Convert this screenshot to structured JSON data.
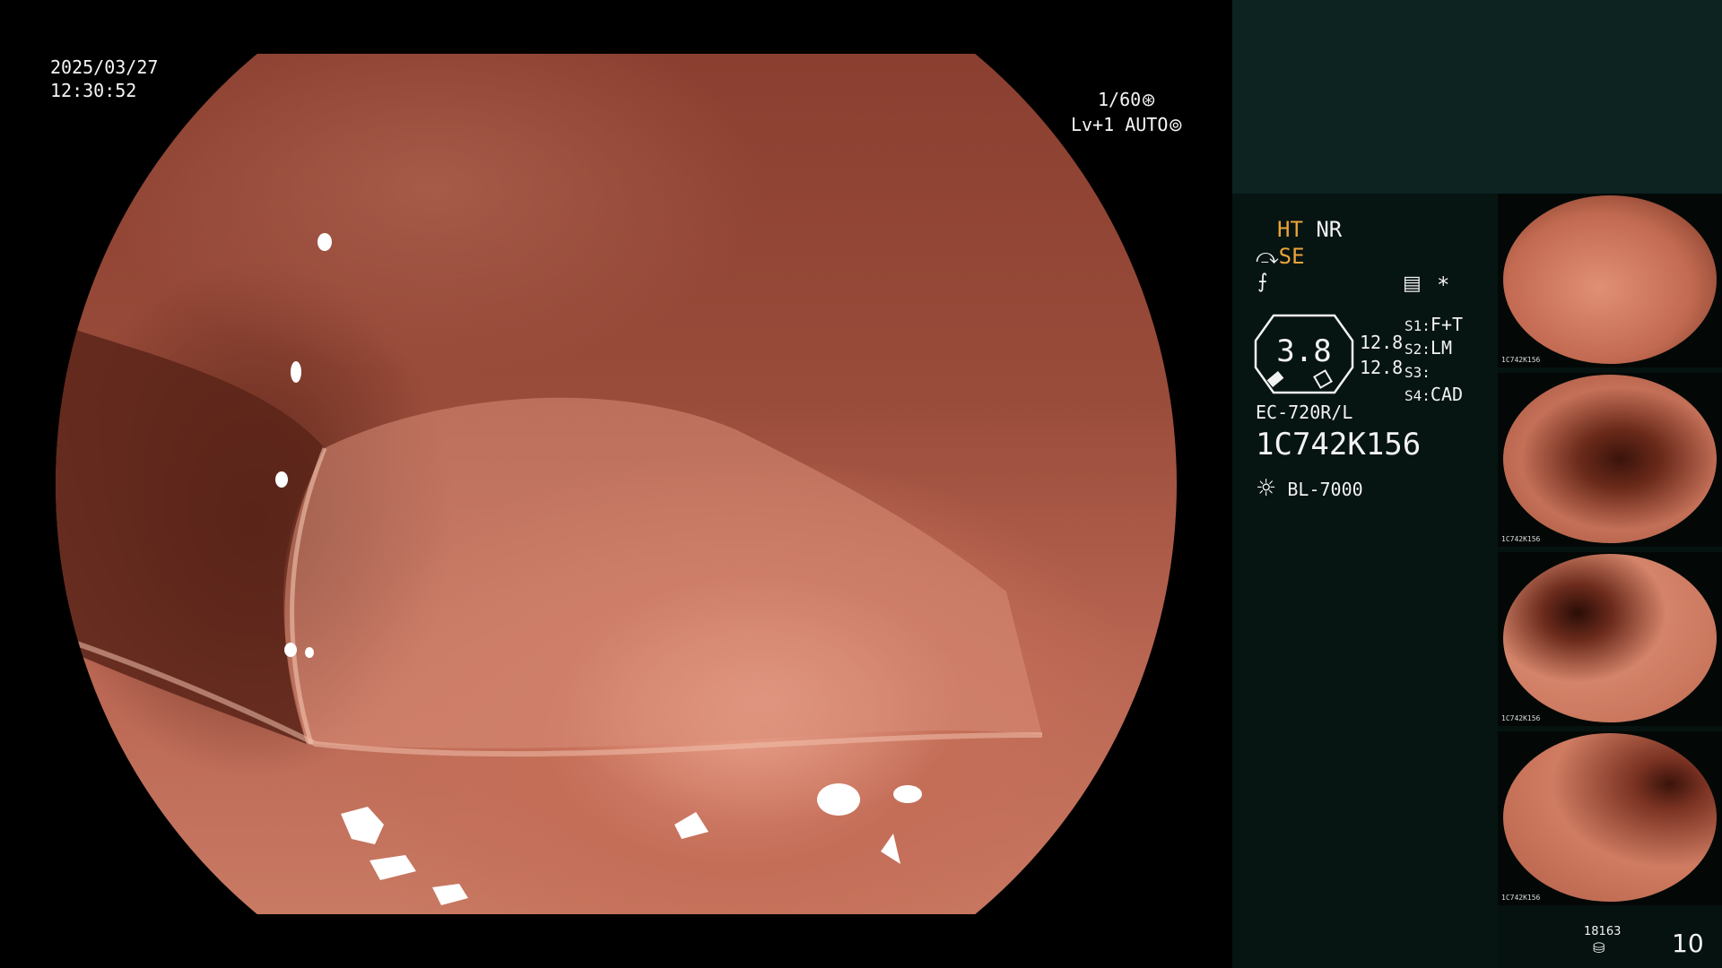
{
  "overlay": {
    "date": "2025/03/27",
    "time": "12:30:52",
    "shutter": "1/60",
    "shutter_icon": "⊛",
    "level": "Lv+1",
    "mode": "AUTO",
    "mode_icon": "⊚"
  },
  "panel": {
    "ht": "HT",
    "nr": "NR",
    "se_icon": "⤼",
    "se": "SE",
    "f_icon": "⨍",
    "settings_icon": "▤",
    "asterisk": "*",
    "zoom_value": "3.8",
    "value_top": "12.8",
    "value_bottom": "12.8",
    "s1_label": "S1:",
    "s1_value": "F+T",
    "s2_label": "S2:",
    "s2_value": "LM",
    "s3_label": "S3:",
    "s3_value": "",
    "s4_label": "S4:",
    "s4_value": "CAD",
    "scope_model": "EC-720R/L",
    "serial": "1C742K156",
    "light_icon": "☼",
    "light_source": "BL-7000",
    "storage_count": "18163",
    "storage_icon": "⛁",
    "image_count": "10"
  },
  "thumbnails": [
    {
      "label": "1C742K156"
    },
    {
      "label": "1C742K156"
    },
    {
      "label": "1C742K156"
    },
    {
      "label": "1C742K156"
    }
  ],
  "colors": {
    "accent_orange": "#e8a53a",
    "panel_dark": "#061412",
    "panel_top": "#0c2322",
    "mucosa": "#c46e58"
  }
}
